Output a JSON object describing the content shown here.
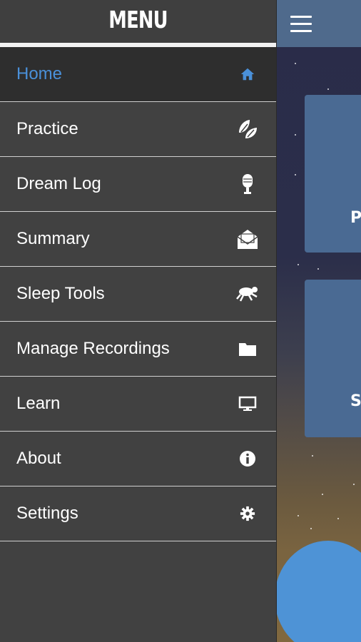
{
  "drawer": {
    "title": "MENU",
    "items": [
      {
        "label": "Home",
        "icon": "home-icon",
        "active": true
      },
      {
        "label": "Practice",
        "icon": "leaves-icon",
        "active": false
      },
      {
        "label": "Dream Log",
        "icon": "microphone-icon",
        "active": false
      },
      {
        "label": "Summary",
        "icon": "open-envelope-icon",
        "active": false
      },
      {
        "label": "Sleep Tools",
        "icon": "jumping-sheep-icon",
        "active": false
      },
      {
        "label": "Manage Recordings",
        "icon": "folder-icon",
        "active": false
      },
      {
        "label": "Learn",
        "icon": "monitor-icon",
        "active": false
      },
      {
        "label": "About",
        "icon": "info-icon",
        "active": false
      },
      {
        "label": "Settings",
        "icon": "gear-icon",
        "active": false
      }
    ]
  },
  "background_app": {
    "menu_icon": "hamburger-menu-icon",
    "card_1_text": "PI",
    "card_2_text": "SU"
  },
  "colors": {
    "active_item": "#4a90d9",
    "drawer_bg": "#414141",
    "app_bar": "#4f6a8c",
    "card": "#4a6a93",
    "planet": "#4e93d6"
  }
}
